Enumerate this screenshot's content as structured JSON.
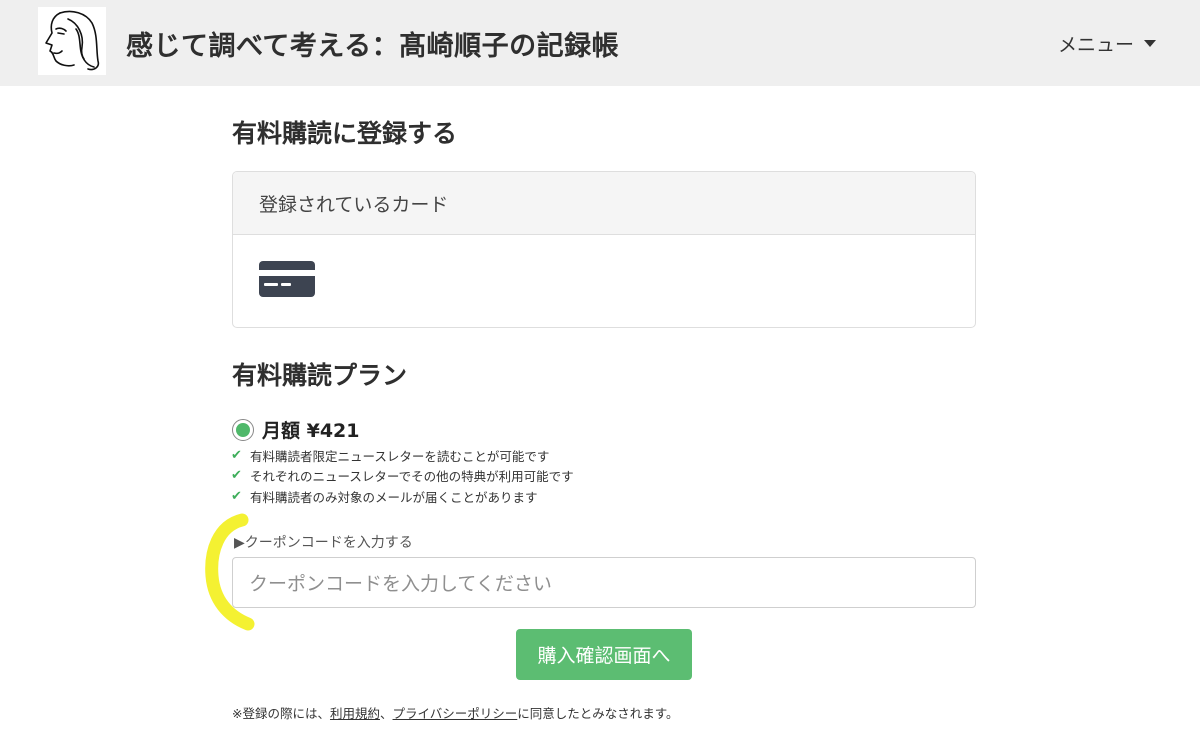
{
  "header": {
    "title": "感じて調べて考える：髙崎順子の記録帳",
    "menu_label": "メニュー",
    "logo_icon": "face-sketch-logo"
  },
  "subscribe": {
    "heading": "有料購読に登録する",
    "card_panel_title": "登録されているカード",
    "card_icon": "credit-card-icon"
  },
  "plans": {
    "heading": "有料購読プラン",
    "selected_plan": "月額 ¥421",
    "features": [
      "有料購読者限定ニュースレターを読むことが可能です",
      "それぞれのニュースレターでその他の特典が利用可能です",
      "有料購読者のみ対象のメールが届くことがあります"
    ],
    "accent_color": "#4fb86a"
  },
  "coupon": {
    "toggle_label": "▶クーポンコードを入力する",
    "placeholder": "クーポンコードを入力してください"
  },
  "actions": {
    "buy_label": "購入確認画面へ"
  },
  "footer": {
    "prefix": "※登録の際には、",
    "terms_link": "利用規約",
    "separator": "、",
    "privacy_link": "プライバシーポリシー",
    "suffix": "に同意したとみなされます。"
  }
}
